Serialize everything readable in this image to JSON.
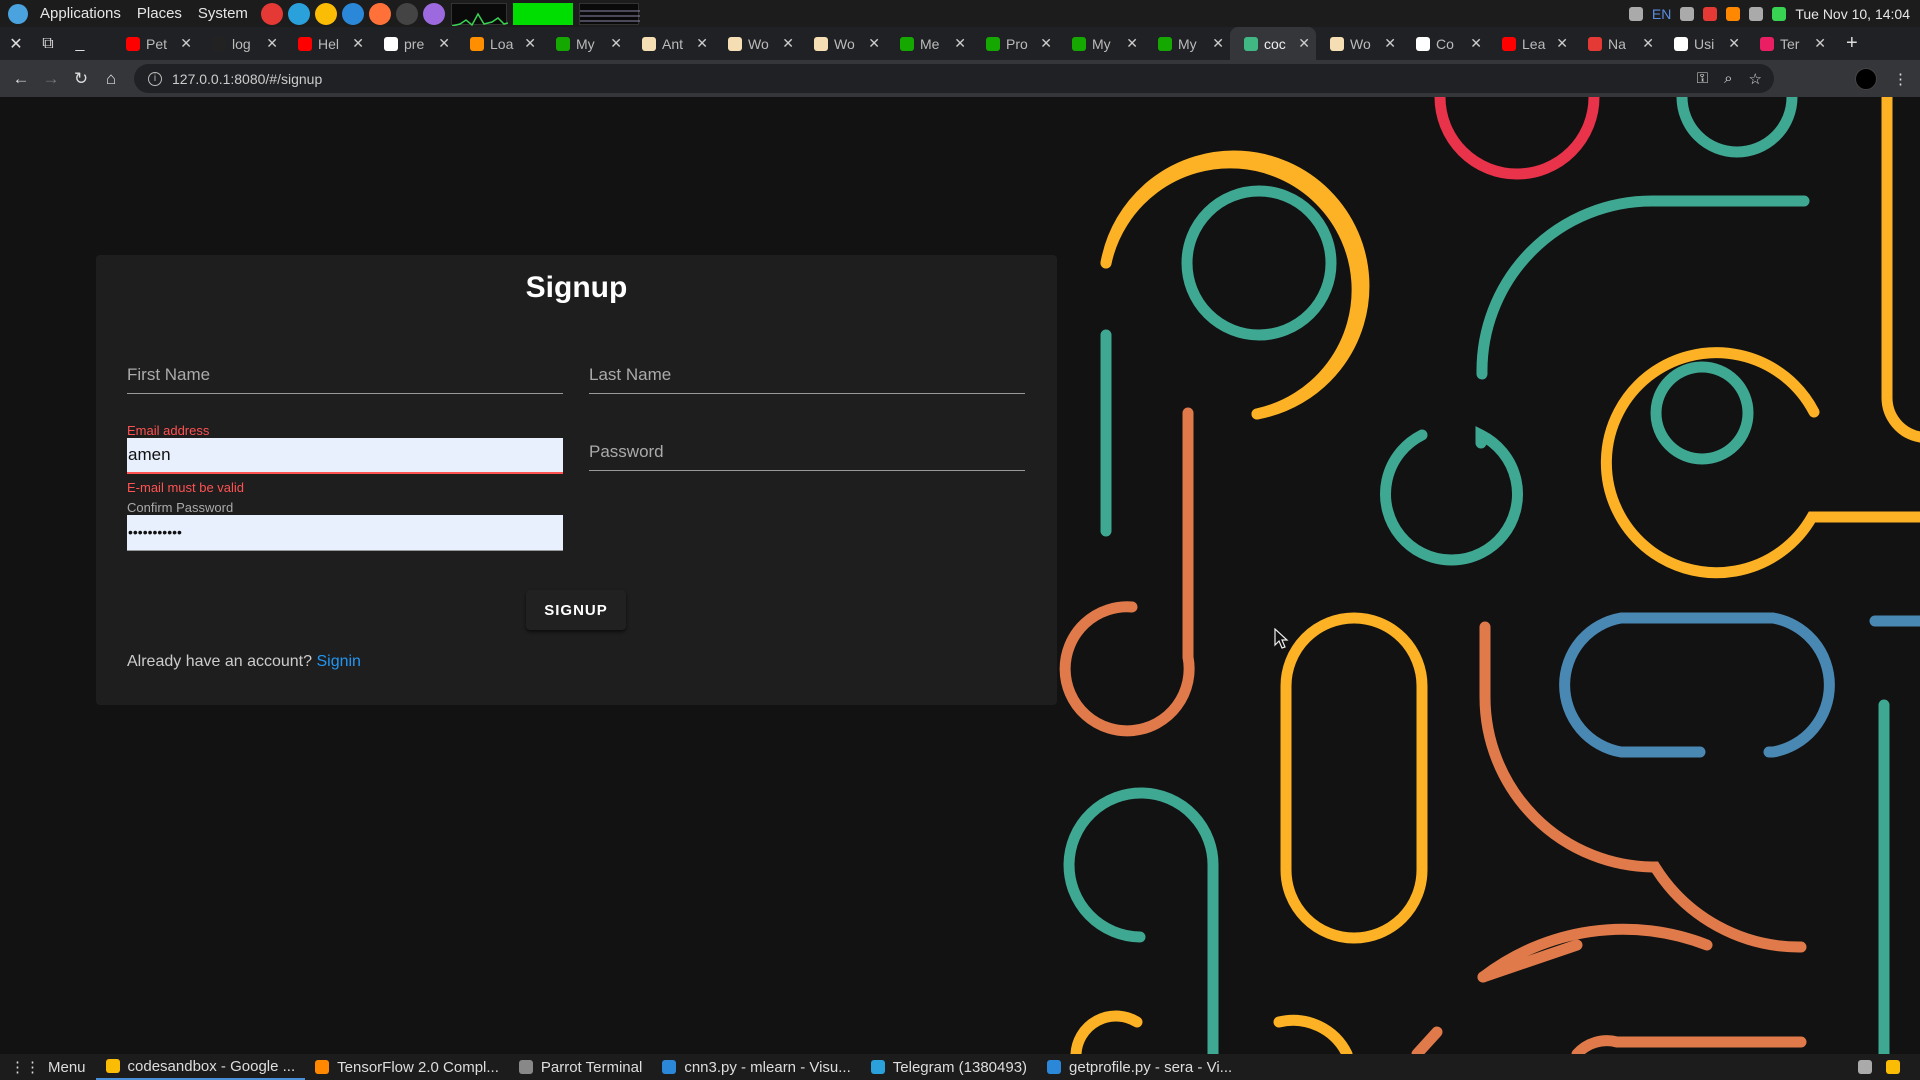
{
  "system_bar": {
    "menus": [
      "Applications",
      "Places",
      "System"
    ],
    "language": "EN",
    "clock": "Tue Nov 10, 14:04"
  },
  "tabs": [
    {
      "title": "Pet",
      "favicon": "youtube-icon",
      "color": "#ff0000"
    },
    {
      "title": "log",
      "favicon": "github-icon",
      "color": "#222222"
    },
    {
      "title": "Hel",
      "favicon": "youtube-icon",
      "color": "#ff0000"
    },
    {
      "title": "pre",
      "favicon": "google-icon",
      "color": "#ffffff"
    },
    {
      "title": "Loa",
      "favicon": "tensorflow-icon",
      "color": "#ff8f00"
    },
    {
      "title": "My",
      "favicon": "upwork-icon",
      "color": "#14a800"
    },
    {
      "title": "Ant",
      "favicon": "wordpress-icon",
      "color": "#f5deb3"
    },
    {
      "title": "Wo",
      "favicon": "wordpress-icon",
      "color": "#f5deb3"
    },
    {
      "title": "Wo",
      "favicon": "wordpress-icon",
      "color": "#f5deb3"
    },
    {
      "title": "Me",
      "favicon": "upwork-icon",
      "color": "#14a800"
    },
    {
      "title": "Pro",
      "favicon": "upwork-icon",
      "color": "#14a800"
    },
    {
      "title": "My",
      "favicon": "upwork-icon",
      "color": "#14a800"
    },
    {
      "title": "My",
      "favicon": "upwork-icon",
      "color": "#14a800"
    },
    {
      "title": "coc",
      "favicon": "vue-icon",
      "color": "#41b883",
      "active": true
    },
    {
      "title": "Wo",
      "favicon": "wordpress-icon",
      "color": "#f5deb3"
    },
    {
      "title": "Co",
      "favicon": "globe-icon",
      "color": "#ffffff"
    },
    {
      "title": "Lea",
      "favicon": "youtube-icon",
      "color": "#ff0000"
    },
    {
      "title": "Na",
      "favicon": "infinity-icon",
      "color": "#e53935"
    },
    {
      "title": "Usi",
      "favicon": "globe-icon",
      "color": "#ffffff"
    },
    {
      "title": "Ter",
      "favicon": "record-icon",
      "color": "#e91e63"
    }
  ],
  "address_bar": {
    "url": "127.0.0.1:8080/#/signup"
  },
  "form": {
    "title": "Signup",
    "first_name_label": "First Name",
    "last_name_label": "Last Name",
    "email_label": "Email address",
    "email_value": "amen",
    "email_error": "E-mail must be valid",
    "password_label": "Password",
    "confirm_label": "Confirm Password",
    "confirm_value": "•••••••••••",
    "submit_label": "SIGNUP",
    "account_prompt": "Already have an account?",
    "signin_link": "Signin"
  },
  "colors": {
    "teal": "#3fa892",
    "orange": "#fdb225",
    "coral": "#e07a4a",
    "red": "#e8334a",
    "blue": "#4a88b4",
    "error": "#ff5252",
    "link": "#2196f3"
  },
  "taskbar": {
    "menu_label": "Menu",
    "tasks": [
      {
        "label": "codesandbox - Google ...",
        "icon": "chrome-icon",
        "color": "#fbbc05",
        "active": true
      },
      {
        "label": "TensorFlow 2.0 Compl...",
        "icon": "vlc-icon",
        "color": "#ff8800"
      },
      {
        "label": "Parrot Terminal",
        "icon": "terminal-icon",
        "color": "#888888"
      },
      {
        "label": "cnn3.py - mlearn - Visu...",
        "icon": "vscode-icon",
        "color": "#2b88d8"
      },
      {
        "label": "Telegram (1380493)",
        "icon": "telegram-icon",
        "color": "#2aa1da"
      },
      {
        "label": "getprofile.py - sera - Vi...",
        "icon": "vscode-icon",
        "color": "#2b88d8"
      }
    ]
  }
}
